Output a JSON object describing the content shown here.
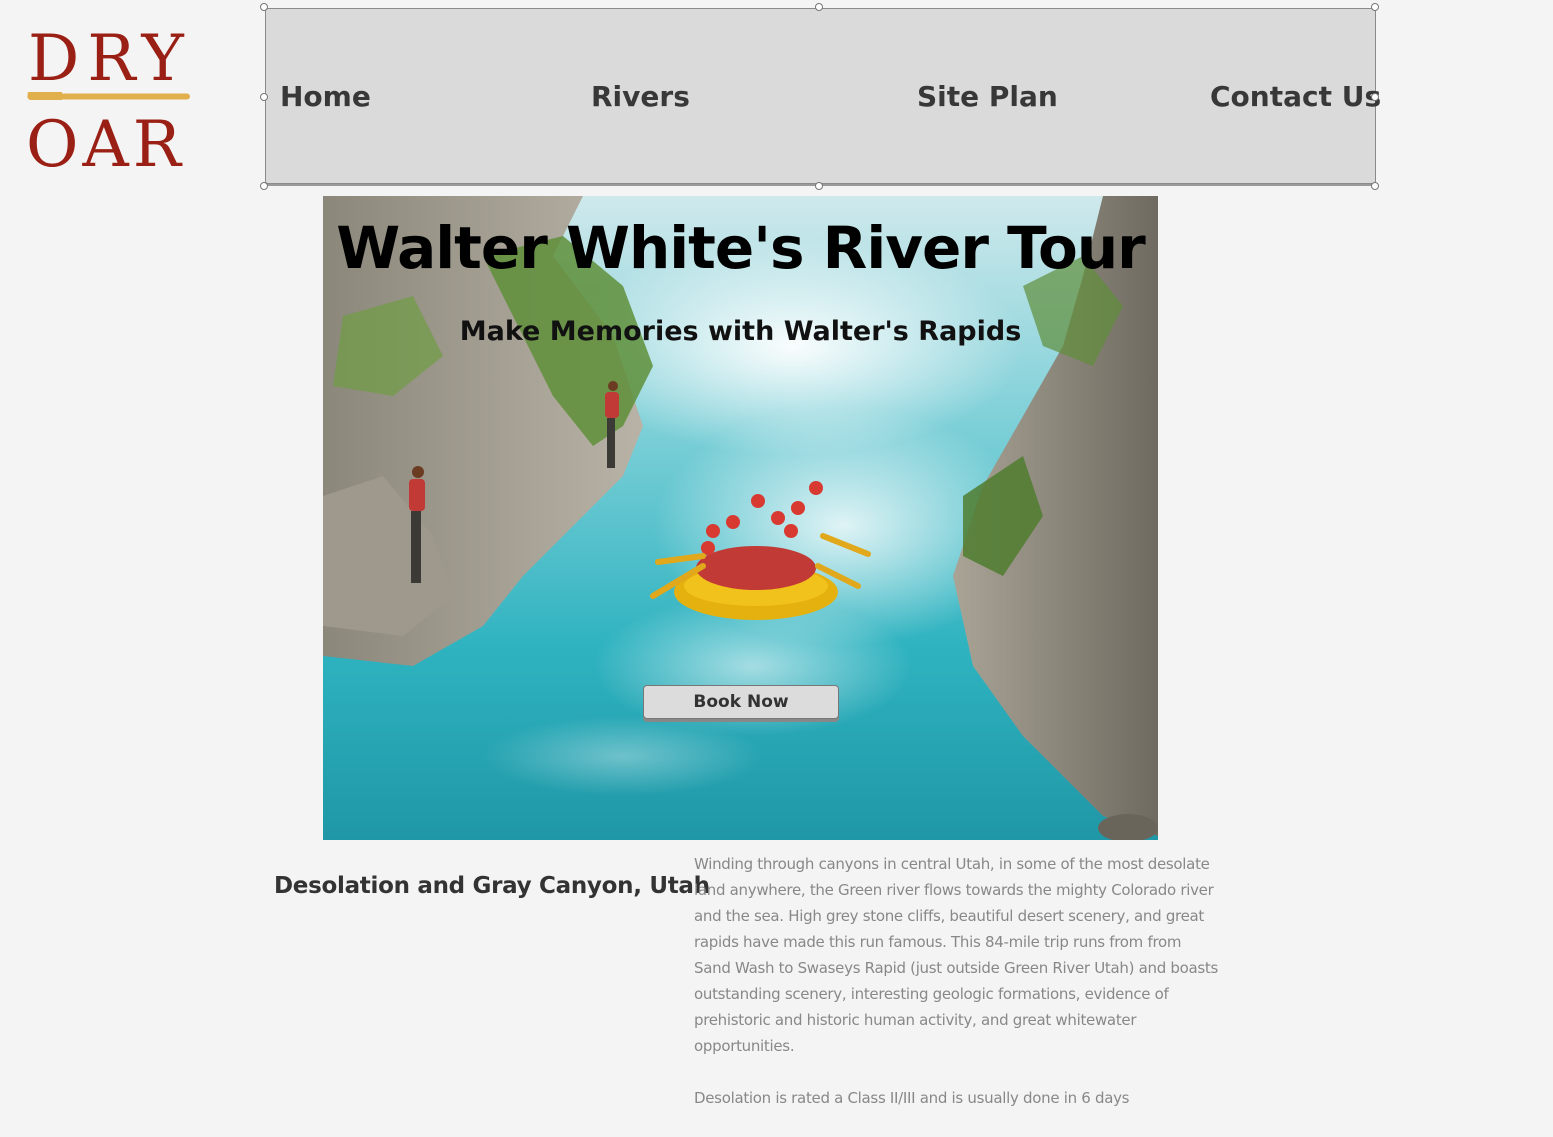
{
  "logo": {
    "line1": "DRY",
    "line2": "OAR",
    "text_color": "#9a1f14",
    "oar_color": "#e1b04c",
    "icon": "oar-icon"
  },
  "nav": {
    "items": [
      {
        "label": "Home"
      },
      {
        "label": "Rivers"
      },
      {
        "label": "Site Plan"
      },
      {
        "label": "Contact Us"
      }
    ]
  },
  "hero": {
    "title": "Walter White's River Tour",
    "subtitle": "Make Memories with Walter's Rapids",
    "button_label": "Book Now",
    "image_description_icon": "river-rafting-photo"
  },
  "section": {
    "title": "Desolation and Gray Canyon, Utah",
    "paragraphs": [
      "Winding through canyons in central Utah, in some of the most desolate land anywhere, the Green river flows towards the mighty Colorado river and the sea. High grey stone cliffs, beautiful desert scenery, and great rapids have made this run famous. This 84-mile trip runs from from Sand Wash to Swaseys Rapid (just outside Green River Utah) and boasts outstanding scenery, interesting geologic formations, evidence of prehistoric and historic human activity, and great whitewater opportunities.",
      "Desolation is rated a Class II/III and is usually done in 6 days"
    ]
  },
  "colors": {
    "background": "#f4f4f4",
    "nav_bg": "#dadada",
    "water": "#2fb3c0",
    "raft": "#f2c21c"
  }
}
